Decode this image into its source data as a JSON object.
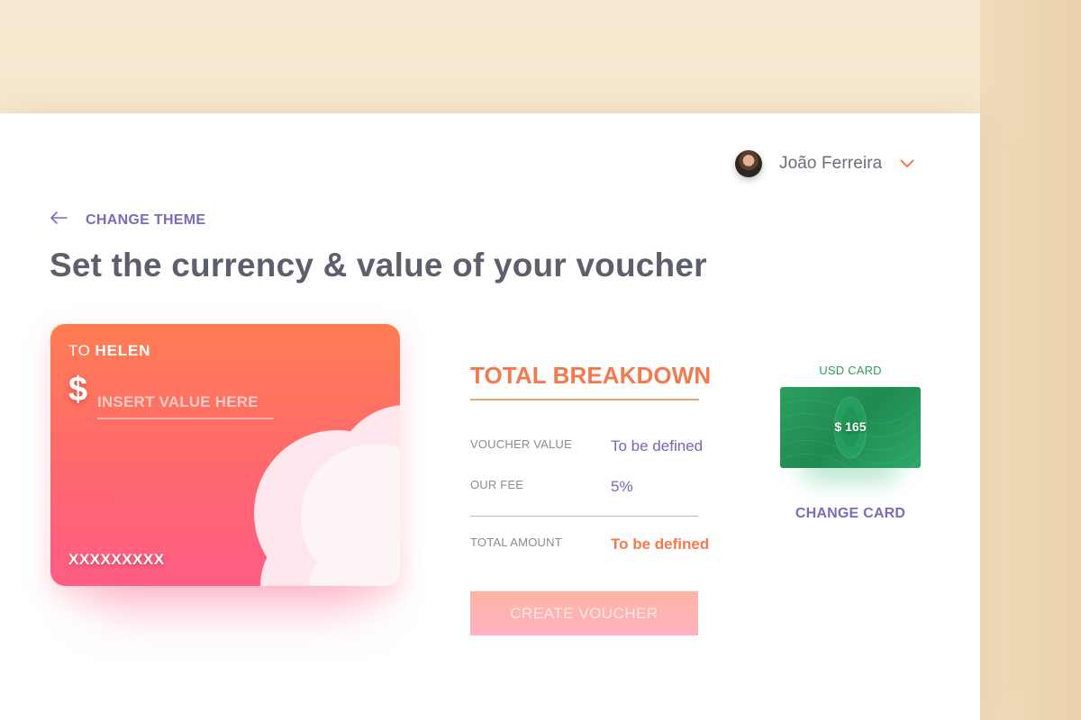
{
  "user": {
    "name": "João Ferreira"
  },
  "nav": {
    "back_label": "CHANGE THEME"
  },
  "page": {
    "title": "Set the currency & value of your voucher"
  },
  "voucher_card": {
    "to_prefix": "TO",
    "recipient": "HELEN",
    "currency_symbol": "$",
    "value_placeholder": "INSERT VALUE HERE",
    "card_number": "XXXXXXXXX",
    "gradient_colors": [
      "#ff7d52",
      "#ff5d85"
    ]
  },
  "breakdown": {
    "title": "TOTAL BREAKDOWN",
    "rows": [
      {
        "label": "VOUCHER VALUE",
        "value": "To be defined"
      },
      {
        "label": "OUR FEE",
        "value": "5%"
      }
    ],
    "total": {
      "label": "TOTAL AMOUNT",
      "value": "To be defined"
    },
    "create_button": "CREATE VOUCHER"
  },
  "selected_card": {
    "label": "USD CARD",
    "amount": "$ 165",
    "change_label": "CHANGE CARD"
  },
  "colors": {
    "accent_purple": "#7b6bb8",
    "accent_orange": "#f47a4e",
    "card_green": "#2c9e60"
  }
}
